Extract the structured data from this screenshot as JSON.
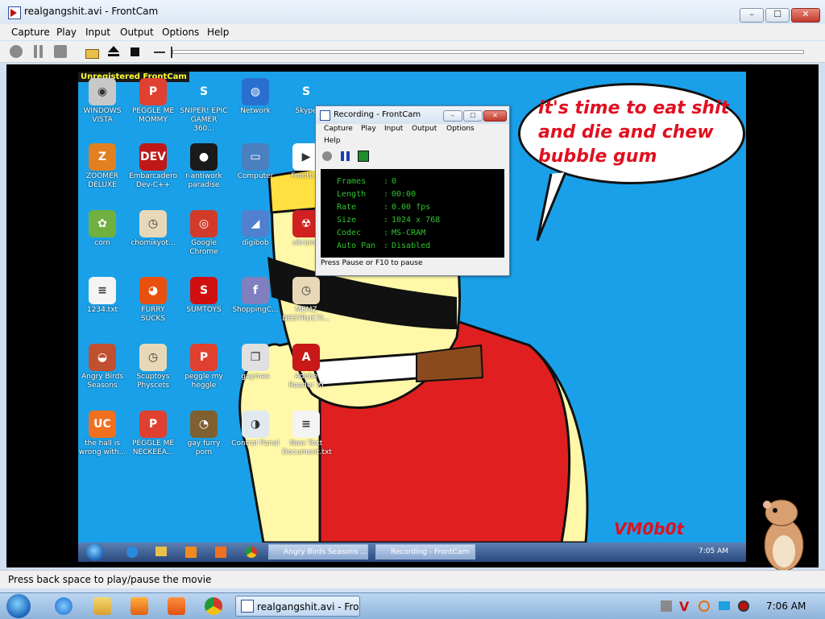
{
  "window": {
    "title": "realgangshit.avi - FrontCam",
    "controls": {
      "minimize": "–",
      "maximize": "☐",
      "close": "✕"
    }
  },
  "menu": [
    "Capture",
    "Play",
    "Input",
    "Output",
    "Options",
    "Help"
  ],
  "toolbar": {
    "icons": [
      "record-icon",
      "pause-icon",
      "stop-square-icon",
      "open-folder-icon",
      "eject-icon",
      "stop-icon"
    ]
  },
  "video": {
    "watermark": "Unregistered FrontCam",
    "desktop_icons": [
      {
        "label": "WINDOWS VISTA",
        "color": "#c8c8c8",
        "glyph": "◉"
      },
      {
        "label": "PEGGLE ME MOMMY",
        "color": "#e04030",
        "glyph": "P"
      },
      {
        "label": "SNIPER! EPIC GAMER 360...",
        "color": "#1aa0e8",
        "glyph": "S"
      },
      {
        "label": "Network",
        "color": "#2a6fd0",
        "glyph": "◍"
      },
      {
        "label": "Skype",
        "color": "#1aa0e8",
        "glyph": "S"
      },
      {
        "label": "ZOOMER DELUXE",
        "color": "#e08020",
        "glyph": "Z"
      },
      {
        "label": "Embarcadero Dev-C++",
        "color": "#c01818",
        "glyph": "DEV"
      },
      {
        "label": "r-antiwork paradise",
        "color": "#1a1a1a",
        "glyph": "●"
      },
      {
        "label": "Computer",
        "color": "#4a80c0",
        "glyph": "▭"
      },
      {
        "label": "FrontC...",
        "color": "#ffffff",
        "glyph": "▶"
      },
      {
        "label": "corn",
        "color": "#70b040",
        "glyph": "✿"
      },
      {
        "label": "chomikyot...",
        "color": "#e8d8b8",
        "glyph": "◷"
      },
      {
        "label": "Google Chrome",
        "color": "#d23a2a",
        "glyph": "◎"
      },
      {
        "label": "digibob",
        "color": "#5080d0",
        "glyph": "◢"
      },
      {
        "label": "ukraine",
        "color": "#d02020",
        "glyph": "☢"
      },
      {
        "label": "1234.txt",
        "color": "#f4f4f4",
        "glyph": "≡"
      },
      {
        "label": "FURRY SUCKS",
        "color": "#e85010",
        "glyph": "◕"
      },
      {
        "label": "SUMTOYS",
        "color": "#d01010",
        "glyph": "S"
      },
      {
        "label": "ShoppingC...",
        "color": "#8080c0",
        "glyph": "f"
      },
      {
        "label": "MEMZ DESTRUCTI...",
        "color": "#e8d8b8",
        "glyph": "◷"
      },
      {
        "label": "Angry Birds Seasons",
        "color": "#c05030",
        "glyph": "◒"
      },
      {
        "label": "Scuptoys Physcets",
        "color": "#e8d8b8",
        "glyph": "◷"
      },
      {
        "label": "peggle my heggle",
        "color": "#e04030",
        "glyph": "P"
      },
      {
        "label": "gaymes",
        "color": "#e0e0e0",
        "glyph": "❐"
      },
      {
        "label": "Adobe Reader XI",
        "color": "#c81818",
        "glyph": "A"
      },
      {
        "label": "the hall is wrong with...",
        "color": "#f07020",
        "glyph": "UC"
      },
      {
        "label": "PEGGLE ME NECKEEA...",
        "color": "#e04030",
        "glyph": "P"
      },
      {
        "label": "gay furry porn",
        "color": "#806030",
        "glyph": "◔"
      },
      {
        "label": "Control Panel",
        "color": "#e0e8f0",
        "glyph": "◑"
      },
      {
        "label": "New Text Document.txt",
        "color": "#f4f4f4",
        "glyph": "≡"
      }
    ],
    "speech_bubble": "it's time to eat shit and die and chew bubble gum",
    "signature": "VM0b0t",
    "recorder": {
      "title": "Recording - FrontCam",
      "menu": [
        "Capture",
        "Play",
        "Input",
        "Output",
        "Options",
        "Help"
      ],
      "stats": [
        {
          "label": "Frames",
          "value": "0"
        },
        {
          "label": "Length",
          "value": "00:00"
        },
        {
          "label": "Rate",
          "value": "0.00  fps"
        },
        {
          "label": "Size",
          "value": "1024 x 768"
        },
        {
          "label": "Codec",
          "value": "MS-CRAM"
        },
        {
          "label": "Auto Pan",
          "value": "Disabled"
        }
      ],
      "status": "Press Pause or F10 to pause"
    },
    "inner_taskbar": {
      "items": [
        "Angry Birds Seasons ...",
        "Recording - FrontCam"
      ],
      "clock": "7:05 AM"
    }
  },
  "statusbar": {
    "text": "Press back space to play/pause the movie"
  },
  "taskbar": {
    "pinned": [
      "internet-explorer-icon",
      "file-explorer-icon",
      "media-player-icon",
      "ucbrowser-icon",
      "chrome-icon"
    ],
    "active_task": "realgangshit.avi - Fro...",
    "clock": "7:06 AM"
  }
}
